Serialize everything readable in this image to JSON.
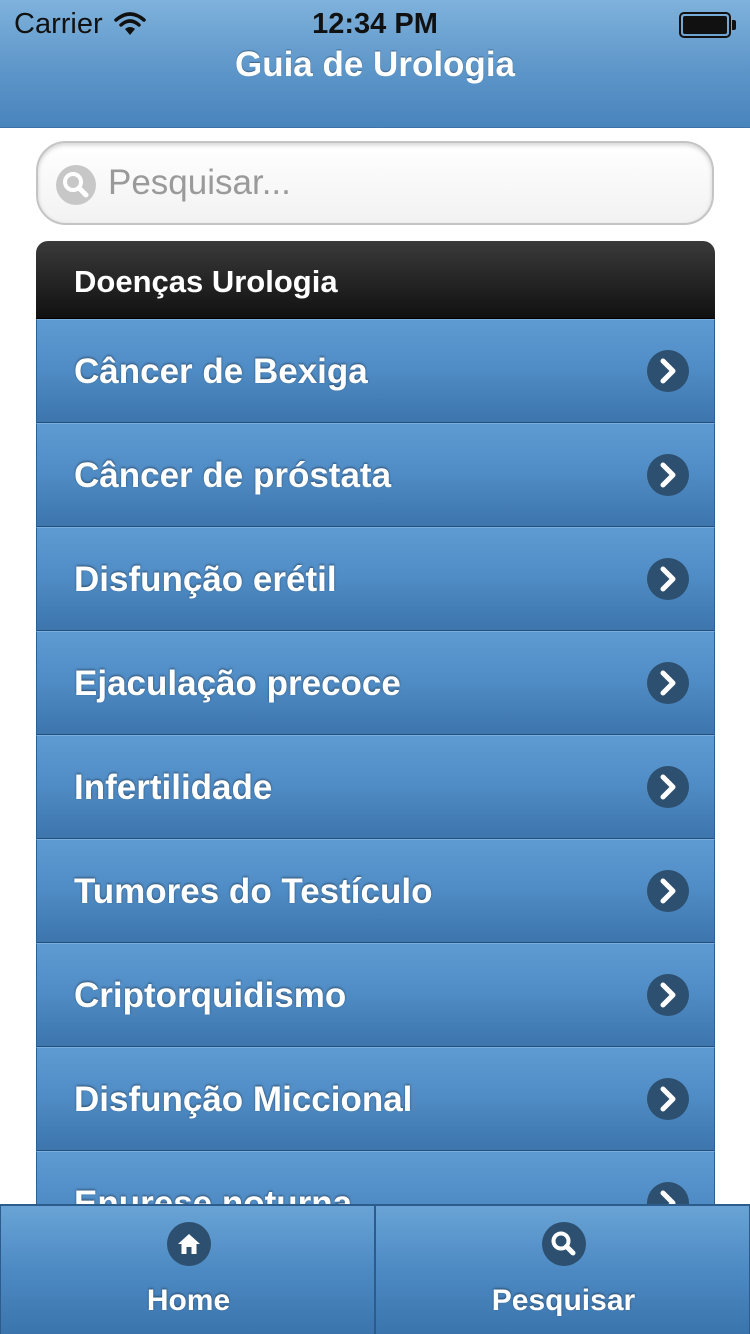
{
  "status_bar": {
    "carrier": "Carrier",
    "time": "12:34 PM"
  },
  "header": {
    "title": "Guia de Urologia"
  },
  "search": {
    "placeholder": "Pesquisar...",
    "value": ""
  },
  "list": {
    "divider": "Doenças Urologia",
    "items": [
      {
        "label": "Câncer de Bexiga"
      },
      {
        "label": "Câncer de próstata"
      },
      {
        "label": "Disfunção erétil"
      },
      {
        "label": "Ejaculação precoce"
      },
      {
        "label": "Infertilidade"
      },
      {
        "label": "Tumores do Testículo"
      },
      {
        "label": "Criptorquidismo"
      },
      {
        "label": "Disfunção Miccional"
      },
      {
        "label": "Enurese noturna"
      }
    ]
  },
  "tabbar": {
    "home_label": "Home",
    "search_label": "Pesquisar"
  },
  "icons": {
    "wifi": "wifi-icon",
    "battery": "battery-icon",
    "search": "search-icon",
    "chevron": "chevron-right-icon",
    "home": "home-icon"
  },
  "colors": {
    "header_blue": "#5d96c9",
    "list_item_blue": "#4f8bc4",
    "divider_black": "#111111",
    "chevron_circle": "#2d4f70"
  }
}
